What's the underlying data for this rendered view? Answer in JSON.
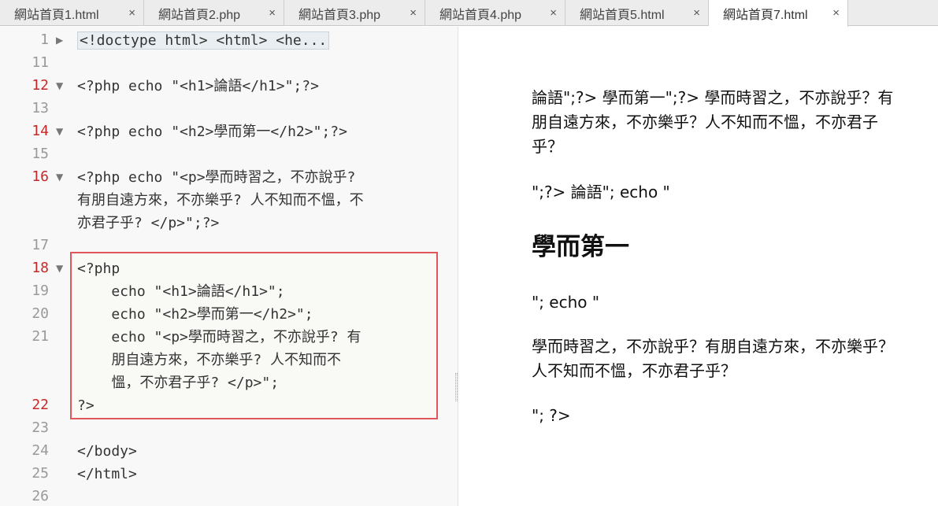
{
  "tabs": [
    {
      "label": "網站首頁1.html",
      "active": false
    },
    {
      "label": "網站首頁2.php",
      "active": false
    },
    {
      "label": "網站首頁3.php",
      "active": false
    },
    {
      "label": "網站首頁4.php",
      "active": false
    },
    {
      "label": "網站首頁5.html",
      "active": false
    },
    {
      "label": "網站首頁7.html",
      "active": true
    }
  ],
  "close_glyph": "×",
  "editor": {
    "line_numbers": [
      "1",
      "11",
      "12",
      "13",
      "14",
      "15",
      "16",
      "17",
      "18",
      "19",
      "20",
      "21",
      "22",
      "23",
      "24",
      "25",
      "26"
    ],
    "lines": {
      "l1": "<!doctype html> <html> <he...",
      "l12": "<?php echo \"<h1>論語</h1>\";?>",
      "l14": "<?php echo \"<h2>學而第一</h2>\";?>",
      "l16a": "<?php echo \"<p>學而時習之，不亦說乎?",
      "l16b": "有朋自遠方來，不亦樂乎? 人不知而不慍，不",
      "l16c": "亦君子乎? </p>\";?>",
      "l18": "<?php",
      "l19": "    echo \"<h1>論語</h1>\";",
      "l20": "    echo \"<h2>學而第一</h2>\";",
      "l21a": "    echo \"<p>學而時習之，不亦說乎? 有",
      "l21b": "    朋自遠方來，不亦樂乎? 人不知而不",
      "l21c": "    慍，不亦君子乎? </p>\";",
      "l22": "?>",
      "l24": "</body>",
      "l25": "</html>"
    }
  },
  "preview": {
    "p1": "論語\";?> 學而第一\";?> 學而時習之，不亦說乎？有朋自遠方來，不亦樂乎？人不知而不慍，不亦君子乎？",
    "p2": "\";?> 論語\"; echo \"",
    "h2": "學而第一",
    "p3": "\"; echo \"",
    "p4": "學而時習之，不亦說乎？有朋自遠方來，不亦樂乎？人不知而不慍，不亦君子乎？",
    "p5": "\"; ?>"
  }
}
